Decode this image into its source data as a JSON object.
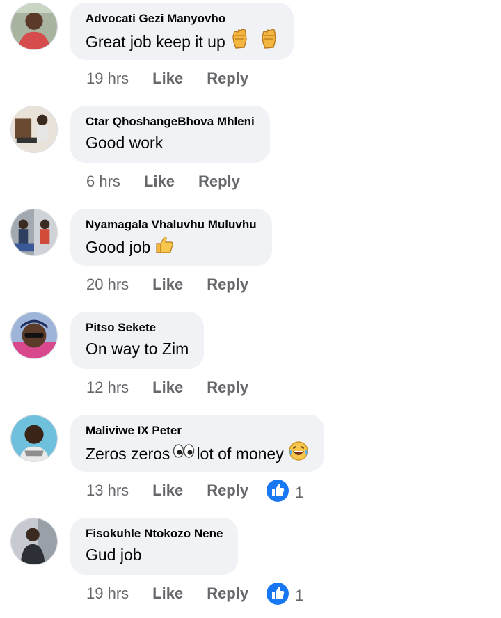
{
  "comments": [
    {
      "author": "Advocati Gezi Manyovho",
      "text": "Great job keep it up",
      "time": "19 hrs",
      "like": "Like",
      "reply": "Reply",
      "emojis": [
        "raised-fist-icon",
        "raised-fist-icon"
      ],
      "reactions": null,
      "avatar_color": "#c0392b"
    },
    {
      "author": "Ctar QhoshangeBhova Mhleni",
      "text": "Good work",
      "time": "6 hrs",
      "like": "Like",
      "reply": "Reply",
      "emojis": [],
      "reactions": null,
      "avatar_color": "#7f5a3a"
    },
    {
      "author": "Nyamagala Vhaluvhu Muluvhu",
      "text": "Good job",
      "time": "20 hrs",
      "like": "Like",
      "reply": "Reply",
      "emojis": [
        "thumbs-up-icon"
      ],
      "reactions": null,
      "avatar_color": "#8a8f99"
    },
    {
      "author": "Pitso Sekete",
      "text": "On way to Zim",
      "time": "12 hrs",
      "like": "Like",
      "reply": "Reply",
      "emojis": [],
      "reactions": null,
      "avatar_color": "#2e4a8f"
    },
    {
      "author": "Maliviwe IX Peter",
      "text_before": "Zeros zeros",
      "text_after": "lot of money",
      "time": "13 hrs",
      "like": "Like",
      "reply": "Reply",
      "emojis": [
        "eyes-icon",
        "laughing-tears-icon"
      ],
      "reactions": "1",
      "avatar_color": "#5aa7c9"
    },
    {
      "author": "Fisokuhle Ntokozo Nene",
      "text": "Gud job",
      "time": "19 hrs",
      "like": "Like",
      "reply": "Reply",
      "emojis": [],
      "reactions": "1",
      "avatar_color": "#4b4f56"
    }
  ],
  "colors": {
    "bubble": "#f0f2f5",
    "meta": "#65676b",
    "like_reaction": "#1877f2"
  }
}
